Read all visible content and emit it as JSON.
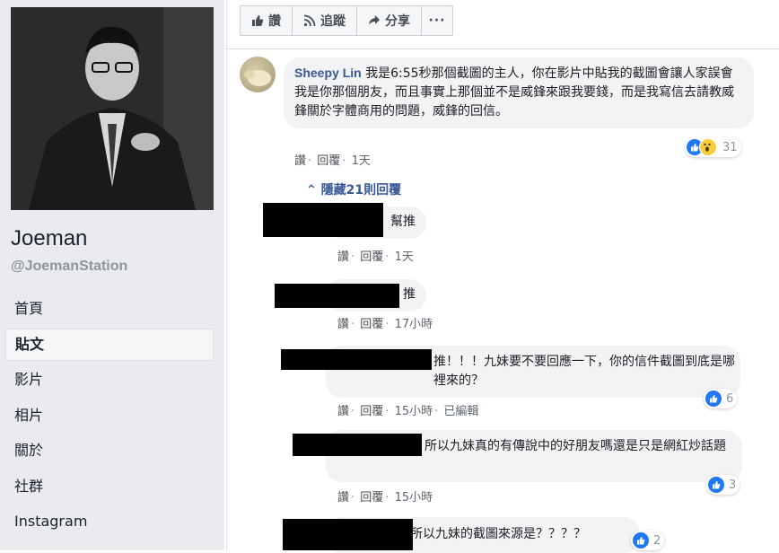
{
  "sidebar": {
    "page_name": "Joeman",
    "page_handle": "@JoemanStation",
    "nav": [
      {
        "label": "首頁",
        "active": false
      },
      {
        "label": "貼文",
        "active": true
      },
      {
        "label": "影片",
        "active": false
      },
      {
        "label": "相片",
        "active": false
      },
      {
        "label": "關於",
        "active": false
      },
      {
        "label": "社群",
        "active": false
      },
      {
        "label": "Instagram",
        "active": false
      }
    ]
  },
  "actions": {
    "like": "讚",
    "follow": "追蹤",
    "share": "分享",
    "more": "···"
  },
  "main_comment": {
    "author": "Sheepy Lin",
    "text": "我是6:55秒那個截圖的主人，你在影片中貼我的截圖會讓人家誤會我是你那個朋友，而且事實上那個並不是威鋒來跟我要錢，而是我寫信去請教威鋒關於字體商用的問題，威鋒的回信。",
    "like": "讚",
    "reply": "回覆",
    "time": "1天",
    "reaction_count": "31"
  },
  "hidden_replies": "隱藏21則回覆",
  "replies": [
    {
      "text": "幫推",
      "like": "讚",
      "reply": "回覆",
      "time": "1天",
      "edited": "",
      "reaction_count": ""
    },
    {
      "text": "推",
      "like": "讚",
      "reply": "回覆",
      "time": "17小時",
      "edited": "",
      "reaction_count": ""
    },
    {
      "text": "推！！！九妹要不要回應一下，你的信件截圖到底是哪裡來的？",
      "like": "讚",
      "reply": "回覆",
      "time": "15小時",
      "edited": "已編輯",
      "reaction_count": "6"
    },
    {
      "text": "所以九妹真的有傳說中的好朋友嗎還是只是網紅炒話題",
      "like": "讚",
      "reply": "回覆",
      "time": "15小時",
      "edited": "",
      "reaction_count": "3"
    },
    {
      "text": "所以九妹的截圖來源是？？？？",
      "like": "",
      "reply": "",
      "time": "",
      "edited": "",
      "reaction_count": "2"
    }
  ],
  "colors": {
    "sidebar_bg": "#e9ebee",
    "bubble_bg": "#f2f3f5",
    "link_blue": "#385898",
    "like_blue": "#2078f4"
  }
}
